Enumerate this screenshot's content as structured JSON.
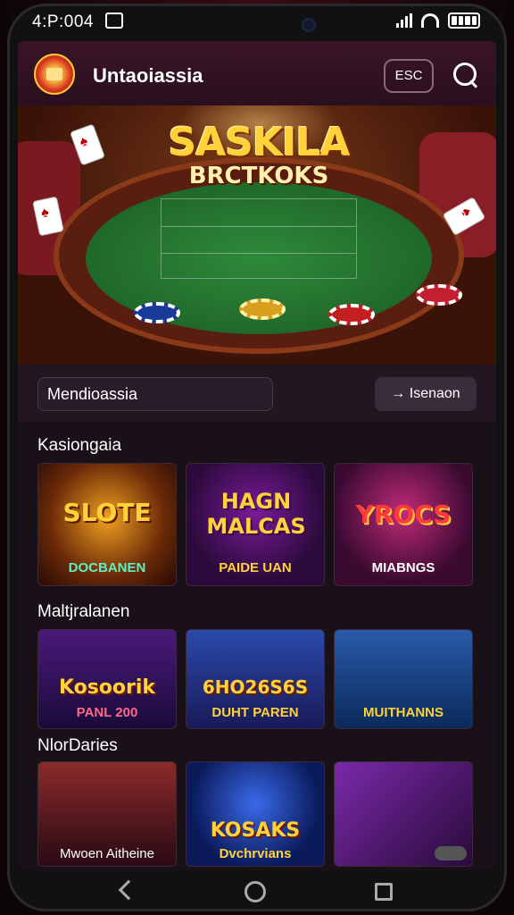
{
  "status": {
    "time": "4:P:004"
  },
  "header": {
    "title": "Untaoiassia",
    "button_label": "ESC"
  },
  "hero": {
    "title": "SASKILA",
    "subtitle": "BRCTKOKS"
  },
  "promo": {
    "input_value": "Mendioassia",
    "button_label": "→ Isenaon"
  },
  "sections": [
    {
      "title": "Kasiongaia",
      "tiles": [
        {
          "title": "SLOTE",
          "subtitle": "DOCBANEN"
        },
        {
          "title": "HAGN MALCAS",
          "subtitle": "PAIDE UAN"
        },
        {
          "title": "YROCS",
          "subtitle": "MIABNGS"
        }
      ]
    },
    {
      "title": "Maltjralanen",
      "tiles": [
        {
          "title": "Kosoorik",
          "subtitle": "PANL 200"
        },
        {
          "title": "6HO26S6S",
          "subtitle": "DUHT PAREN"
        },
        {
          "title": "",
          "subtitle": "MUITHANNS"
        }
      ]
    },
    {
      "title": "NlorDaries",
      "tiles": [
        {
          "title": "",
          "subtitle": "Mwoen Aitheine"
        },
        {
          "title": "KOSAKS",
          "subtitle": "Dvchrvians"
        },
        {
          "title": "",
          "subtitle": ""
        }
      ]
    }
  ],
  "icons": {
    "logo": "casino-logo-icon",
    "search": "search-icon",
    "back": "back-icon",
    "home": "home-icon",
    "recent": "recent-apps-icon"
  },
  "colors": {
    "accent": "#ffd23a",
    "background": "#1a1018",
    "header": "#3a1526"
  }
}
